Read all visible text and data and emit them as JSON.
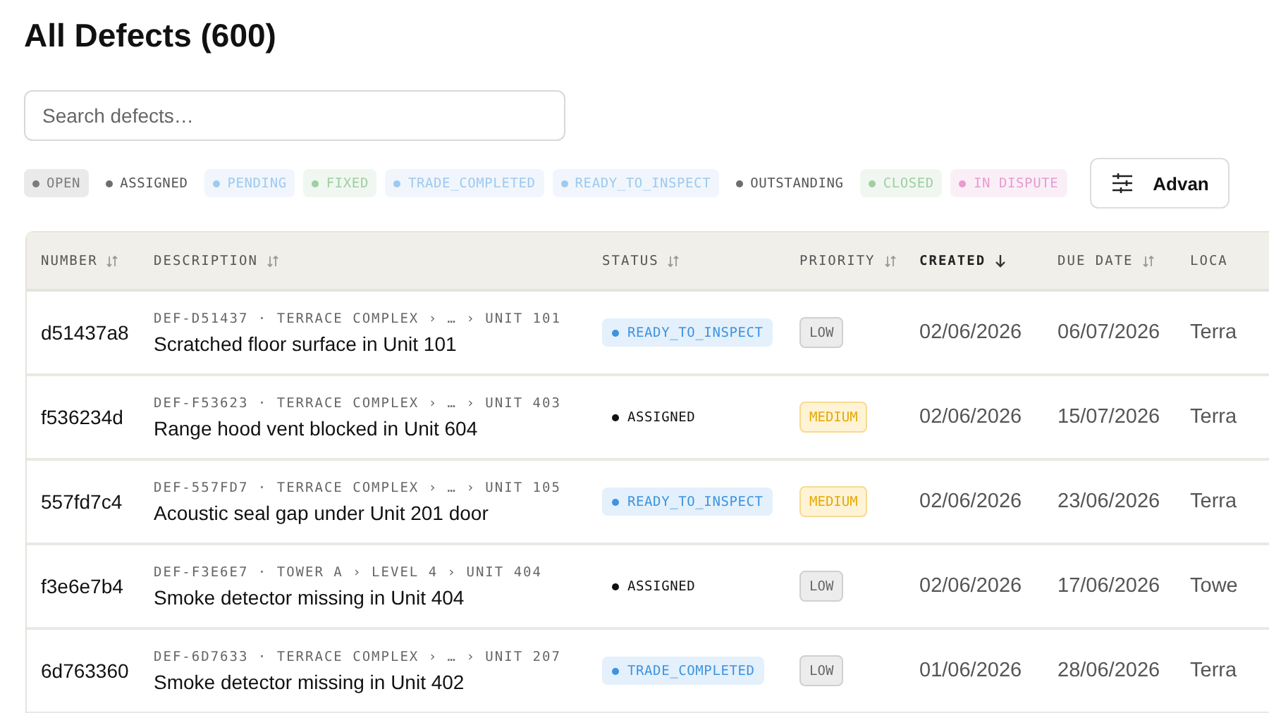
{
  "title": "All Defects (600)",
  "search": {
    "placeholder": "Search defects…"
  },
  "filters": [
    {
      "label": "OPEN",
      "kind": "tinted",
      "color": "#7c7c7c"
    },
    {
      "label": "ASSIGNED",
      "kind": "plain",
      "color": "#6e6e6e"
    },
    {
      "label": "PENDING",
      "kind": "tinted",
      "color": "#9fc9ef"
    },
    {
      "label": "FIXED",
      "kind": "tinted",
      "color": "#9fcfa2"
    },
    {
      "label": "TRADE_COMPLETED",
      "kind": "tinted",
      "color": "#9fc9ef"
    },
    {
      "label": "READY_TO_INSPECT",
      "kind": "tinted",
      "color": "#9fc9ef"
    },
    {
      "label": "OUTSTANDING",
      "kind": "plain",
      "color": "#6e6e6e"
    },
    {
      "label": "CLOSED",
      "kind": "tinted",
      "color": "#9fcfa2"
    },
    {
      "label": "IN DISPUTE",
      "kind": "tinted",
      "color": "#e79bd0"
    }
  ],
  "advanced_button": {
    "label": "Advan"
  },
  "table": {
    "columns": [
      {
        "label": "NUMBER",
        "sortable": true,
        "sorted": false
      },
      {
        "label": "DESCRIPTION",
        "sortable": true,
        "sorted": false
      },
      {
        "label": "STATUS",
        "sortable": true,
        "sorted": false
      },
      {
        "label": "PRIORITY",
        "sortable": true,
        "sorted": false
      },
      {
        "label": "CREATED",
        "sortable": true,
        "sorted": true
      },
      {
        "label": "DUE DATE",
        "sortable": true,
        "sorted": false
      },
      {
        "label": "LOCA"
      }
    ],
    "rows": [
      {
        "number": "d51437a8",
        "ref": "DEF-D51437 · TERRACE COMPLEX › … › UNIT 101",
        "description": "Scratched floor surface in Unit 101",
        "status": {
          "label": "READY_TO_INSPECT",
          "kind": "tinted",
          "color": "#3d93e0"
        },
        "priority": {
          "label": "LOW",
          "kind": "low"
        },
        "created": "02/06/2026",
        "due": "06/07/2026",
        "location": "Terra"
      },
      {
        "number": "f536234d",
        "ref": "DEF-F53623 · TERRACE COMPLEX › … › UNIT 403",
        "description": "Range hood vent blocked in Unit 604",
        "status": {
          "label": "ASSIGNED",
          "kind": "plain",
          "color": "#111111"
        },
        "priority": {
          "label": "MEDIUM",
          "kind": "medium"
        },
        "created": "02/06/2026",
        "due": "15/07/2026",
        "location": "Terra"
      },
      {
        "number": "557fd7c4",
        "ref": "DEF-557FD7 · TERRACE COMPLEX › … › UNIT 105",
        "description": "Acoustic seal gap under Unit 201 door",
        "status": {
          "label": "READY_TO_INSPECT",
          "kind": "tinted",
          "color": "#3d93e0"
        },
        "priority": {
          "label": "MEDIUM",
          "kind": "medium"
        },
        "created": "02/06/2026",
        "due": "23/06/2026",
        "location": "Terra"
      },
      {
        "number": "f3e6e7b4",
        "ref": "DEF-F3E6E7 · TOWER A › LEVEL 4 › UNIT 404",
        "description": "Smoke detector missing in Unit 404",
        "status": {
          "label": "ASSIGNED",
          "kind": "plain",
          "color": "#111111"
        },
        "priority": {
          "label": "LOW",
          "kind": "low"
        },
        "created": "02/06/2026",
        "due": "17/06/2026",
        "location": "Towe"
      },
      {
        "number": "6d763360",
        "ref": "DEF-6D7633 · TERRACE COMPLEX › … › UNIT 207",
        "description": "Smoke detector missing in Unit 402",
        "status": {
          "label": "TRADE_COMPLETED",
          "kind": "tinted",
          "color": "#3d93e0"
        },
        "priority": {
          "label": "LOW",
          "kind": "low"
        },
        "created": "01/06/2026",
        "due": "28/06/2026",
        "location": "Terra"
      }
    ]
  }
}
